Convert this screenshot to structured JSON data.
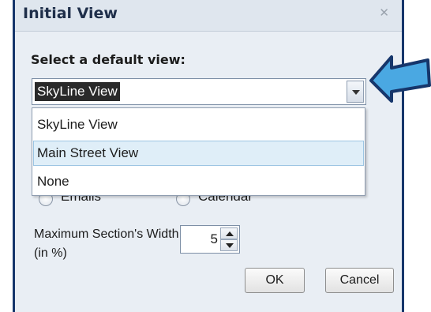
{
  "dialog": {
    "title": "Initial View",
    "close_glyph": "✕",
    "select_label": "Select a default view:",
    "combo": {
      "selected": "SkyLine View",
      "options": [
        "SkyLine View",
        "Main Street View",
        "None"
      ],
      "hovered_index": 1
    },
    "radios": [
      {
        "label": "Emails"
      },
      {
        "label": "Calendar"
      }
    ],
    "max_width": {
      "label": "Maximum Section's Width (in %)",
      "value": "5"
    },
    "buttons": {
      "ok": "OK",
      "cancel": "Cancel"
    }
  },
  "callout": {
    "icon": "arrow-pointer-icon",
    "color": "#4aa8e2",
    "outline": "#16366b"
  }
}
